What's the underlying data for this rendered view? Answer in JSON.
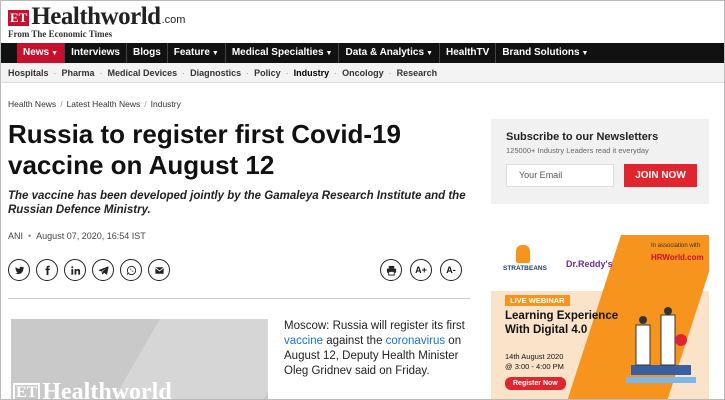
{
  "header": {
    "logo_et": "ET",
    "logo_name": "Healthworld",
    "logo_com": ".com",
    "tagline": "From The Economic Times"
  },
  "nav": {
    "items": [
      {
        "label": "News",
        "dropdown": true,
        "active": true
      },
      {
        "label": "Interviews",
        "dropdown": false
      },
      {
        "label": "Blogs",
        "dropdown": false
      },
      {
        "label": "Feature",
        "dropdown": true
      },
      {
        "label": "Medical Specialties",
        "dropdown": true
      },
      {
        "label": "Data & Analytics",
        "dropdown": true
      },
      {
        "label": "HealthTV",
        "dropdown": false
      },
      {
        "label": "Brand Solutions",
        "dropdown": true
      }
    ]
  },
  "subnav": {
    "items": [
      "Hospitals",
      "Pharma",
      "Medical Devices",
      "Diagnostics",
      "Policy",
      "Industry",
      "Oncology",
      "Research"
    ]
  },
  "breadcrumb": [
    "Health News",
    "Latest Health News",
    "Industry"
  ],
  "article": {
    "title": "Russia to register first Covid-19 vaccine on August 12",
    "summary": "The vaccine has been developed jointly by the Gamaleya Research Institute and the Russian Defence Ministry.",
    "author": "ANI",
    "date": "August 07, 2020, 16:54 IST",
    "body_1": "Moscow: Russia will register its first ",
    "body_link_1": "vaccine",
    "body_2": " against the ",
    "body_link_2": "coronavirus",
    "body_3": " on August 12, Deputy Health Minister Oleg Gridnev said on Friday.",
    "image_logo_et": "ET",
    "image_logo_name": "Healthworld"
  },
  "share": {
    "icons": [
      "twitter-icon",
      "facebook-icon",
      "linkedin-icon",
      "telegram-icon",
      "whatsapp-icon",
      "email-icon"
    ],
    "print_icon": "print-icon",
    "font_increase": "A+",
    "font_decrease": "A-"
  },
  "newsletter": {
    "title": "Subscribe to our Newsletters",
    "subtitle": "125000+ Industry Leaders read it everyday",
    "email_placeholder": "Your Email",
    "button": "JOIN NOW"
  },
  "ad": {
    "sponsor_1": "STRATBEANS",
    "sponsor_2": "Dr.Reddy's",
    "assoc_text": "In association with",
    "assoc_brand": "HRWorld.com",
    "badge": "LIVE WEBINAR",
    "headline": "Learning Experience With Digital 4.0",
    "date_line_1": "14th August 2020",
    "date_line_2": "@ 3:00 - 4:00 PM",
    "cta": "Register Now"
  },
  "colors": {
    "brand_red": "#c8102e",
    "nav_bg": "#111111",
    "cta_red": "#e0252f",
    "link_blue": "#1a73c9",
    "ad_orange": "#f7941d"
  }
}
